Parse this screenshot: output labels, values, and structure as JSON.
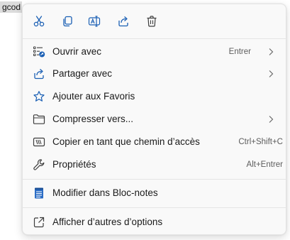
{
  "desktop": {
    "file_label": "gcod"
  },
  "toolbar": {
    "buttons": [
      {
        "name": "cut",
        "icon": "scissors-icon"
      },
      {
        "name": "copy",
        "icon": "copy-icon"
      },
      {
        "name": "rename",
        "icon": "rename-icon"
      },
      {
        "name": "share",
        "icon": "share-icon"
      },
      {
        "name": "delete",
        "icon": "trash-icon"
      }
    ],
    "accent_color": "#1a5fb4"
  },
  "menu": {
    "items": [
      {
        "label": "Ouvrir avec",
        "shortcut": "Entrer",
        "has_submenu": true,
        "icon": "open-with-icon"
      },
      {
        "label": "Partager avec",
        "shortcut": "",
        "has_submenu": true,
        "icon": "share-with-icon"
      },
      {
        "label": "Ajouter aux Favoris",
        "shortcut": "",
        "has_submenu": false,
        "icon": "star-icon"
      },
      {
        "label": "Compresser vers...",
        "shortcut": "",
        "has_submenu": true,
        "icon": "compress-folder-icon"
      },
      {
        "label": "Copier en tant que chemin d’accès",
        "shortcut": "Ctrl+Shift+C",
        "has_submenu": false,
        "icon": "copy-path-icon"
      },
      {
        "label": "Propriétés",
        "shortcut": "Alt+Entrer",
        "has_submenu": false,
        "icon": "wrench-icon"
      },
      {
        "label": "Modifier dans Bloc-notes",
        "shortcut": "",
        "has_submenu": false,
        "icon": "notepad-icon"
      },
      {
        "label": "Afficher d’autres d’options",
        "shortcut": "",
        "has_submenu": false,
        "icon": "more-options-icon"
      }
    ]
  }
}
